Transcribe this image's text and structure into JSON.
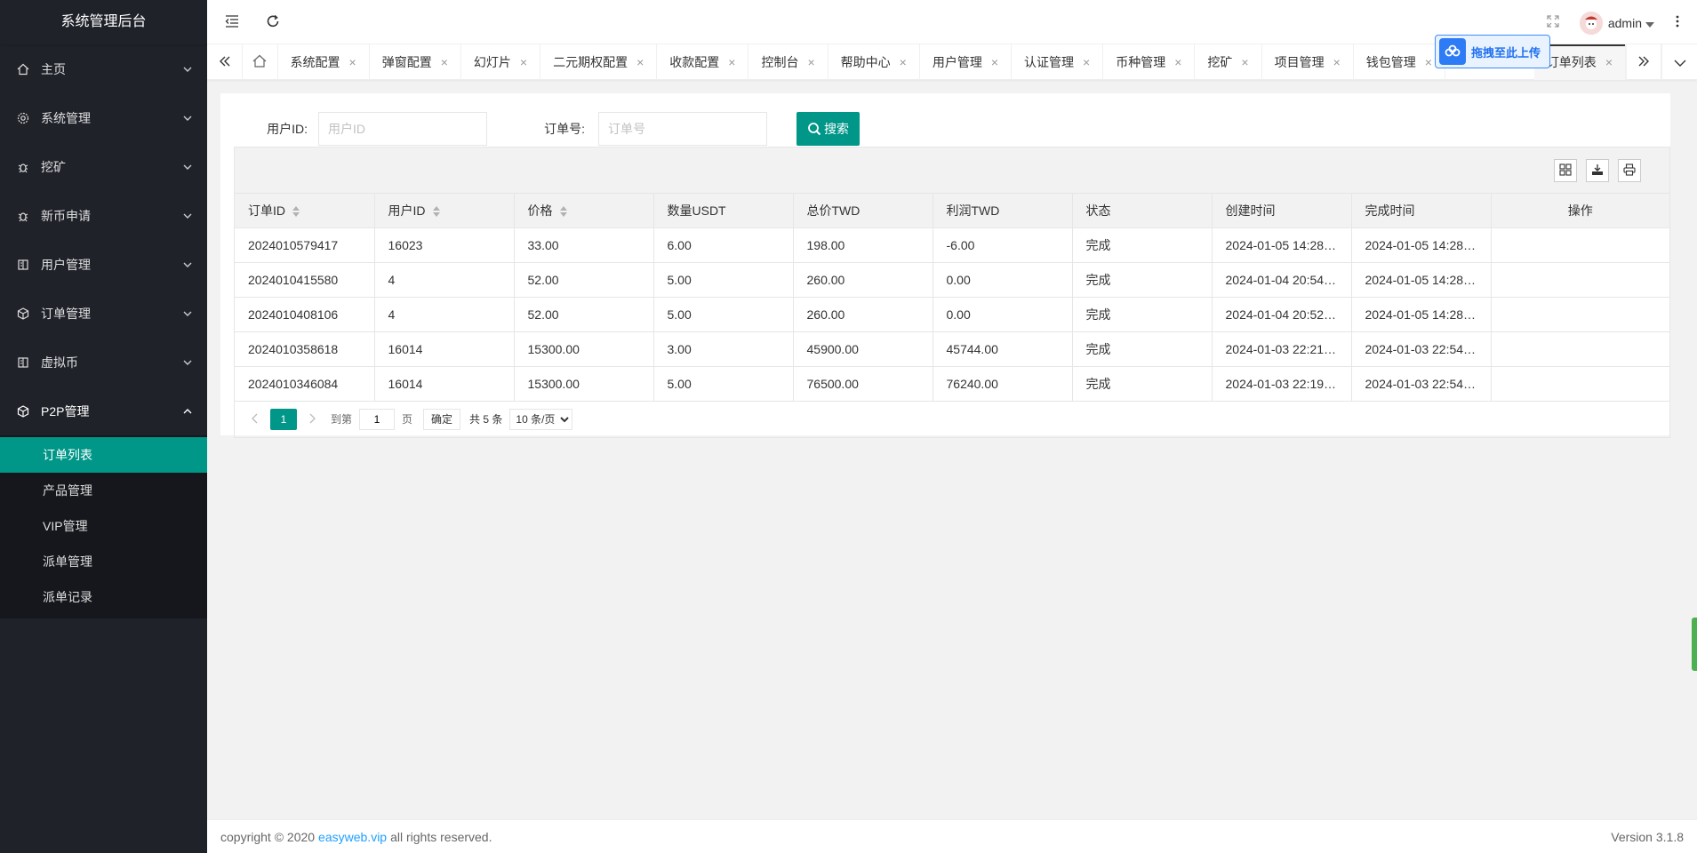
{
  "sidebar": {
    "title": "系统管理后台",
    "items": [
      {
        "label": "主页",
        "icon": "home-icon"
      },
      {
        "label": "系统管理",
        "icon": "gear-icon"
      },
      {
        "label": "挖矿",
        "icon": "bug-icon"
      },
      {
        "label": "新币申请",
        "icon": "bug-icon"
      },
      {
        "label": "用户管理",
        "icon": "book-icon"
      },
      {
        "label": "订单管理",
        "icon": "cube-icon"
      },
      {
        "label": "虚拟币",
        "icon": "book-icon"
      },
      {
        "label": "P2P管理",
        "icon": "cube-icon"
      }
    ],
    "submenu": [
      "订单列表",
      "产品管理",
      "VIP管理",
      "派单管理",
      "派单记录"
    ],
    "active_sub": "订单列表"
  },
  "header": {
    "username": "admin"
  },
  "tabs": [
    "系统配置",
    "弹窗配置",
    "幻灯片",
    "二元期权配置",
    "收款配置",
    "控制台",
    "帮助中心",
    "用户管理",
    "认证管理",
    "币种管理",
    "挖矿",
    "项目管理",
    "钱包管理",
    "订单列表"
  ],
  "upload_label": "拖拽至此上传",
  "search": {
    "user_id_label": "用户ID:",
    "user_id_placeholder": "用户ID",
    "order_no_label": "订单号:",
    "order_no_placeholder": "订单号",
    "button": "搜索"
  },
  "table": {
    "columns": [
      "订单ID",
      "用户ID",
      "价格",
      "数量USDT",
      "总价TWD",
      "利润TWD",
      "状态",
      "创建时间",
      "完成时间",
      "操作"
    ],
    "rows": [
      [
        "2024010579417",
        "16023",
        "33.00",
        "6.00",
        "198.00",
        "-6.00",
        "完成",
        "2024-01-05 14:28…",
        "2024-01-05 14:28…",
        ""
      ],
      [
        "2024010415580",
        "4",
        "52.00",
        "5.00",
        "260.00",
        "0.00",
        "完成",
        "2024-01-04 20:54…",
        "2024-01-05 14:28…",
        ""
      ],
      [
        "2024010408106",
        "4",
        "52.00",
        "5.00",
        "260.00",
        "0.00",
        "完成",
        "2024-01-04 20:52…",
        "2024-01-05 14:28…",
        ""
      ],
      [
        "2024010358618",
        "16014",
        "15300.00",
        "3.00",
        "45900.00",
        "45744.00",
        "完成",
        "2024-01-03 22:21…",
        "2024-01-03 22:54…",
        ""
      ],
      [
        "2024010346084",
        "16014",
        "15300.00",
        "5.00",
        "76500.00",
        "76240.00",
        "完成",
        "2024-01-03 22:19…",
        "2024-01-03 22:54…",
        ""
      ]
    ]
  },
  "pager": {
    "current": "1",
    "goto_label": "到第",
    "goto_value": "1",
    "page_unit": "页",
    "confirm": "确定",
    "total": "共 5 条",
    "page_size": "10 条/页"
  },
  "footer": {
    "copyright": "copyright © 2020",
    "link": "easyweb.vip",
    "rights": "all rights reserved.",
    "version": "Version 3.1.8"
  },
  "colors": {
    "sidebar_bg": "#20222a",
    "accent": "#009688",
    "link": "#1e9fff"
  }
}
